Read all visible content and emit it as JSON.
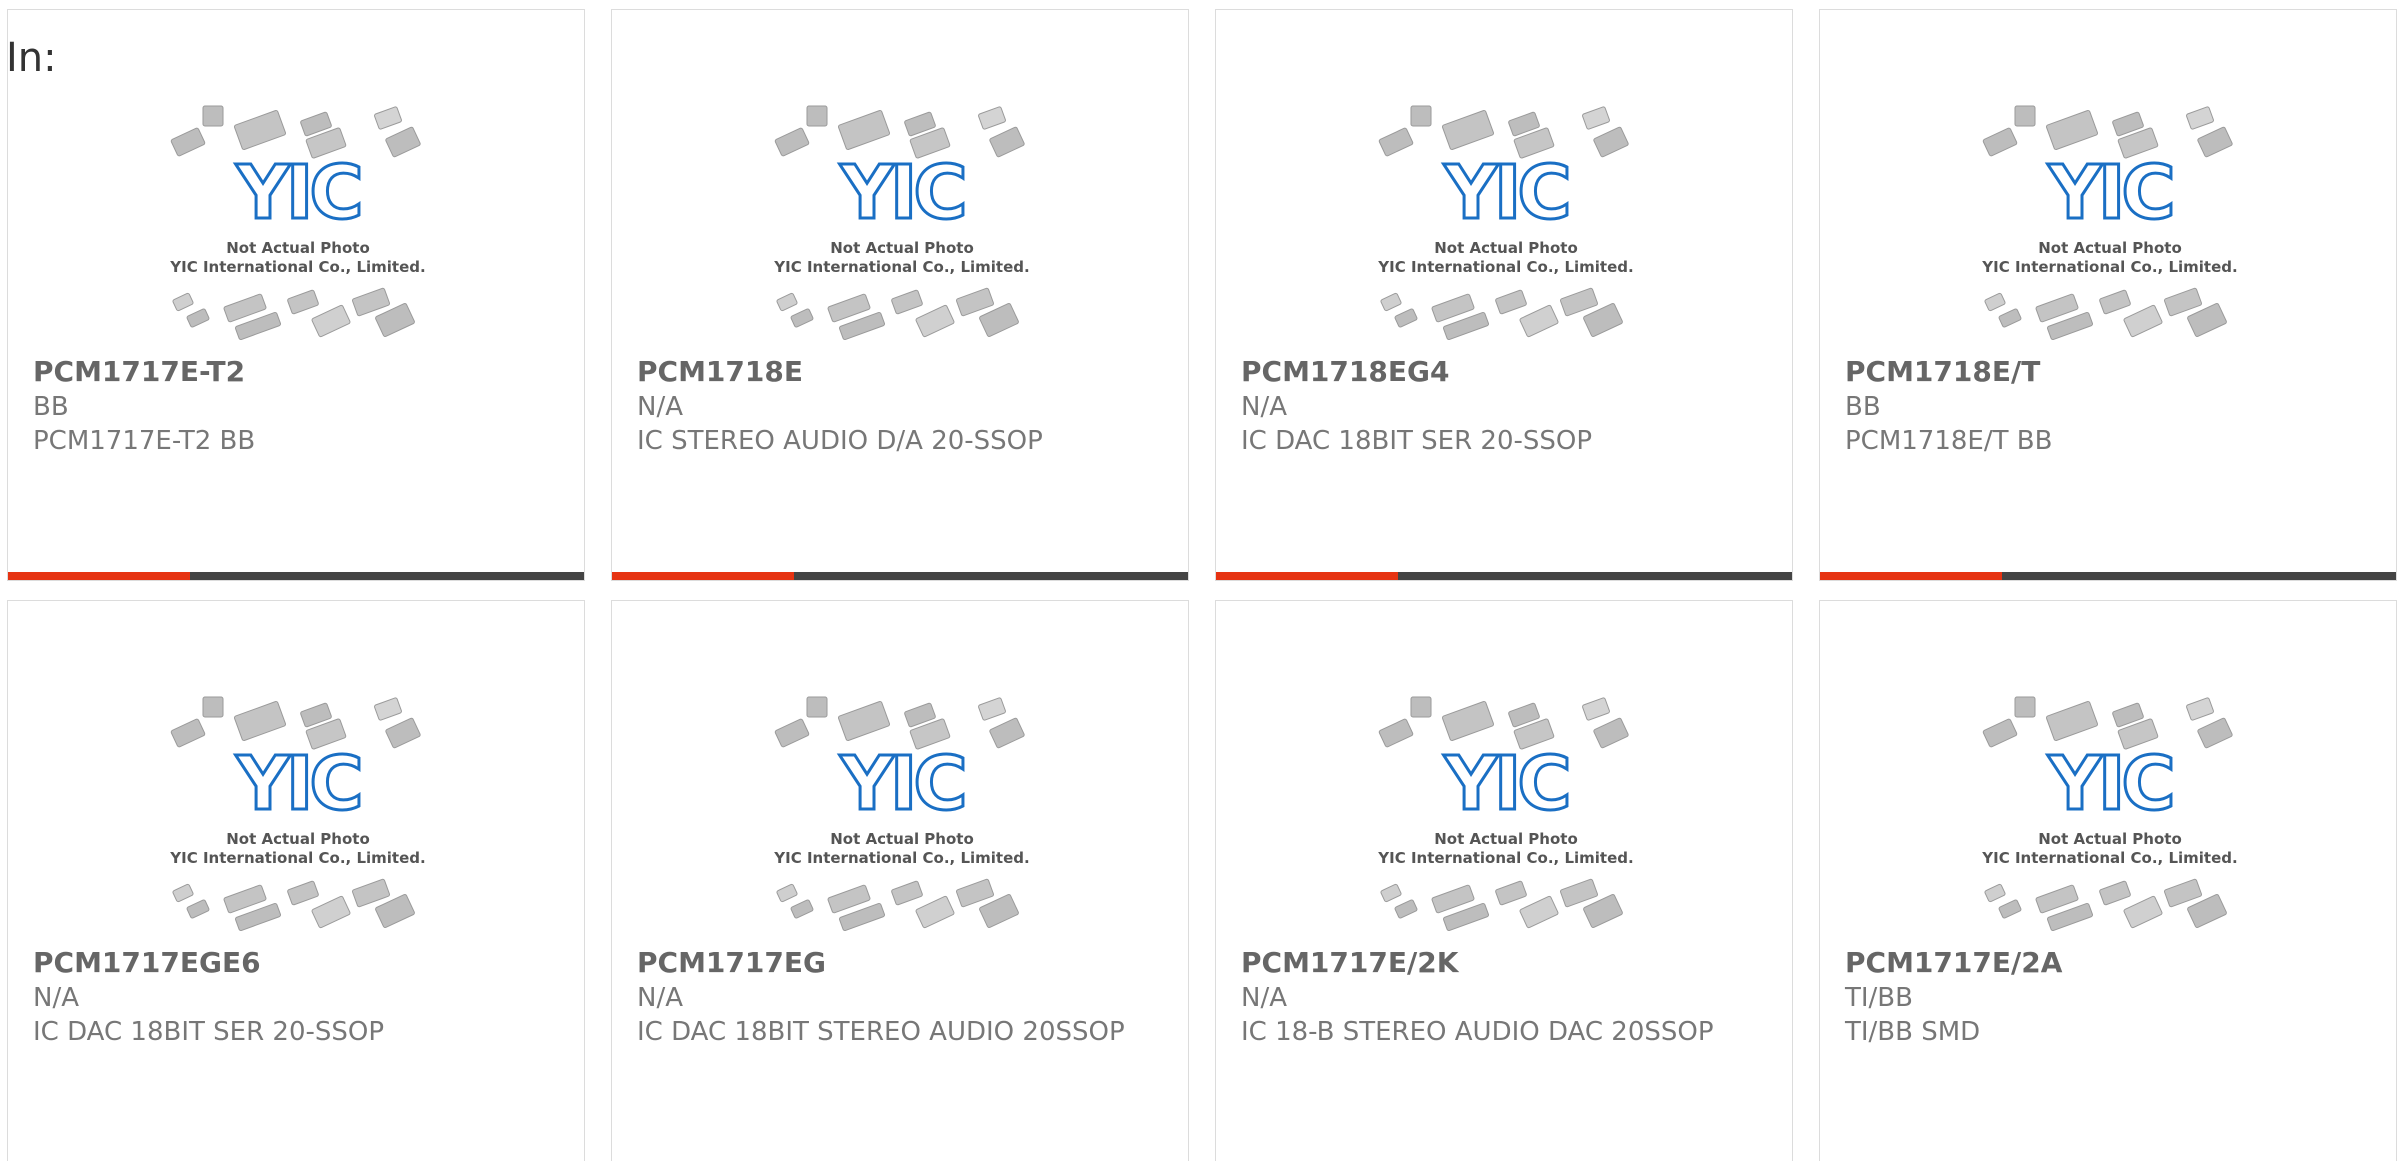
{
  "filter_label": "In:",
  "placeholder_image": {
    "logo_text": "YIC",
    "caption_line1": "Not Actual Photo",
    "caption_line2": "YIC International Co., Limited."
  },
  "colors": {
    "accent": "#e63312",
    "bar": "#444444",
    "logo_blue": "#1a6fc4"
  },
  "products": [
    {
      "part_number": "PCM1717E-T2",
      "manufacturer": "BB",
      "description": "PCM1717E-T2 BB"
    },
    {
      "part_number": "PCM1718E",
      "manufacturer": "N/A",
      "description": "IC STEREO AUDIO D/A 20-SSOP"
    },
    {
      "part_number": "PCM1718EG4",
      "manufacturer": "N/A",
      "description": "IC DAC 18BIT SER 20-SSOP"
    },
    {
      "part_number": "PCM1718E/T",
      "manufacturer": "BB",
      "description": "PCM1718E/T BB"
    },
    {
      "part_number": "PCM1717EGE6",
      "manufacturer": "N/A",
      "description": "IC DAC 18BIT SER 20-SSOP"
    },
    {
      "part_number": "PCM1717EG",
      "manufacturer": "N/A",
      "description": "IC DAC 18BIT STEREO AUDIO 20SSOP"
    },
    {
      "part_number": "PCM1717E/2K",
      "manufacturer": "N/A",
      "description": "IC 18-B STEREO AUDIO DAC 20SSOP"
    },
    {
      "part_number": "PCM1717E/2A",
      "manufacturer": "TI/BB",
      "description": "TI/BB SMD"
    }
  ]
}
